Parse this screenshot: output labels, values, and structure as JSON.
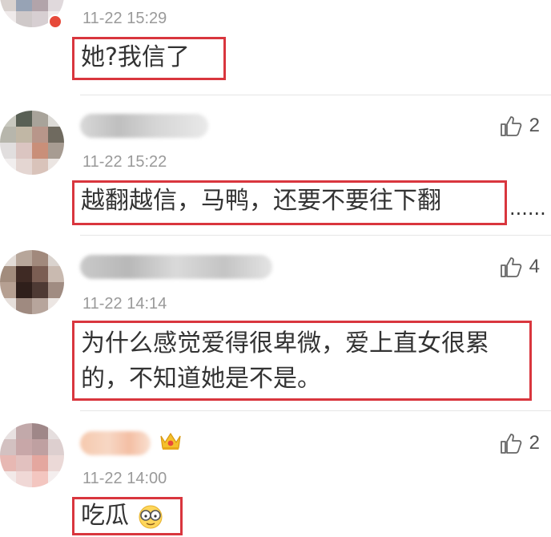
{
  "comments": [
    {
      "time": "11-22 15:29",
      "text": "她?我信了"
    },
    {
      "time": "11-22 15:22",
      "text": "越翻越信，马鸭，还要不要往下翻",
      "overflow": "......",
      "likes": "2"
    },
    {
      "time": "11-22 14:14",
      "text": "为什么感觉爱得很卑微，爱上直女很累的，不知道她是不是。",
      "likes": "4"
    },
    {
      "time": "11-22 14:00",
      "text": "吃瓜",
      "likes": "2"
    }
  ],
  "colors": {
    "highlight_border": "#d9363e",
    "timestamp": "#9a9a9a"
  },
  "icons": {
    "like": "thumbs-up-icon",
    "badge": "crown-icon",
    "emoji": "glasses-face-emoji"
  }
}
